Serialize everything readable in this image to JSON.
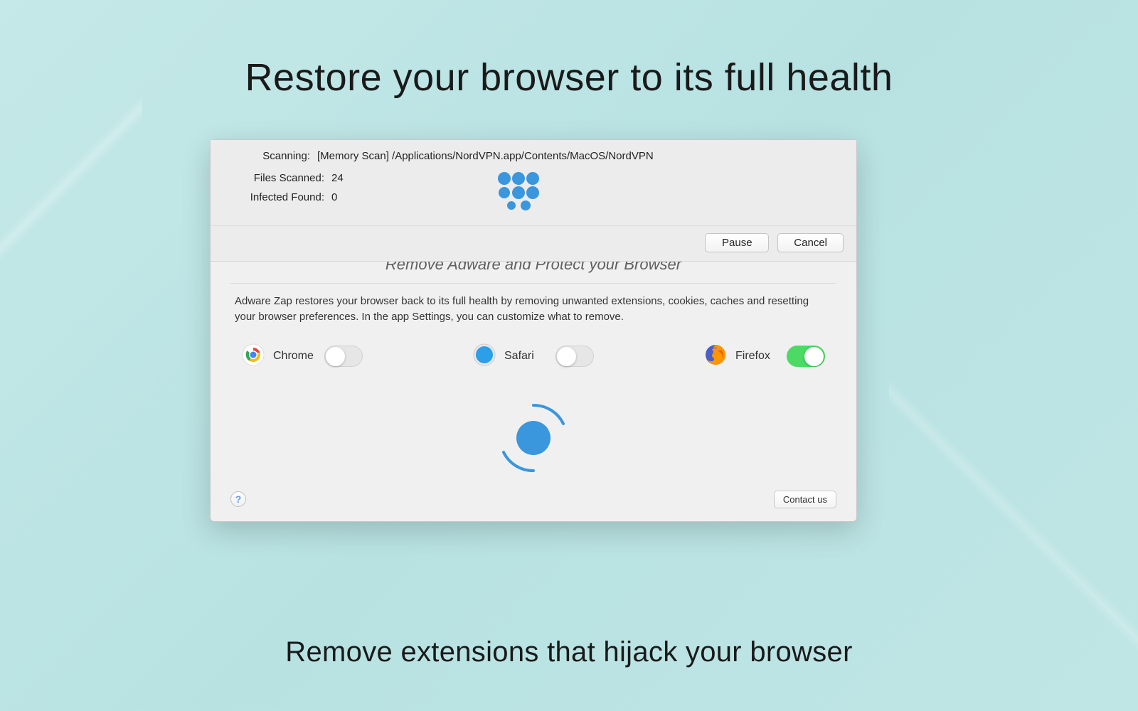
{
  "marketing": {
    "headline": "Restore your browser to its full health",
    "tagline": "Remove extensions that hijack your browser"
  },
  "scan": {
    "scanning_label": "Scanning:",
    "scanning_path": "[Memory Scan] /Applications/NordVPN.app/Contents/MacOS/NordVPN",
    "files_scanned_label": "Files Scanned:",
    "files_scanned_value": "24",
    "infected_found_label": "Infected Found:",
    "infected_found_value": "0",
    "pause_label": "Pause",
    "cancel_label": "Cancel"
  },
  "main": {
    "title_partial": "Remove Adware and Protect your Browser",
    "description": "Adware Zap restores your browser back to its full health by removing unwanted extensions, cookies, caches and resetting your browser preferences. In the app Settings, you can customize what to remove.",
    "browsers": {
      "chrome": {
        "name": "Chrome",
        "enabled": false
      },
      "safari": {
        "name": "Safari",
        "enabled": false
      },
      "firefox": {
        "name": "Firefox",
        "enabled": true
      }
    },
    "help_char": "?",
    "contact_label": "Contact us"
  },
  "colors": {
    "accent_blue": "#3a96dd",
    "toggle_on": "#4cd964"
  }
}
